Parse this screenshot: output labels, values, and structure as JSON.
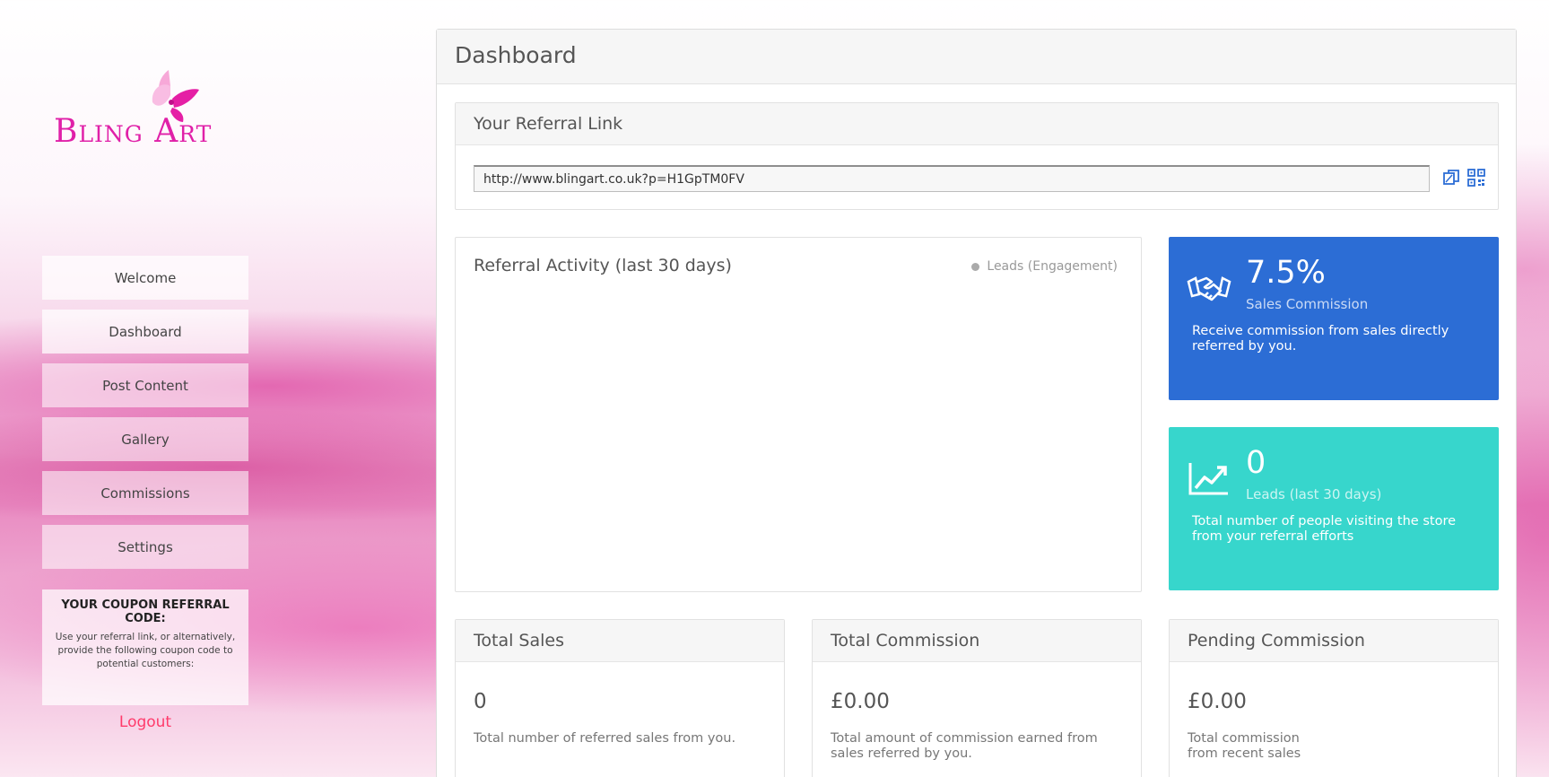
{
  "brand": {
    "logo_text": "Bling Art",
    "primary_pink": "#e020a8"
  },
  "sidebar": {
    "items": [
      {
        "label": "Welcome"
      },
      {
        "label": "Dashboard"
      },
      {
        "label": "Post Content"
      },
      {
        "label": "Gallery"
      },
      {
        "label": "Commissions"
      },
      {
        "label": "Settings"
      }
    ],
    "coupon": {
      "title": "YOUR COUPON REFERRAL CODE:",
      "text": "Use your referral link, or alternatively, provide the following coupon code to potential customers:"
    },
    "logout": "Logout"
  },
  "main": {
    "title": "Dashboard",
    "referral": {
      "title": "Your Referral Link",
      "url": "http://www.blingart.co.uk?p=H1GpTM0FV",
      "copy_icon": "copy-icon",
      "qr_icon": "qr-code-icon"
    },
    "activity": {
      "title": "Referral Activity (last 30 days)",
      "legend": "Leads (Engagement)"
    },
    "commission_box": {
      "value": "7.5%",
      "label": "Sales Commission",
      "desc": "Receive commission from sales directly referred by you.",
      "color": "#2c6dd5",
      "icon": "handshake-icon"
    },
    "leads_box": {
      "value": "0",
      "label": "Leads (last 30 days)",
      "desc": "Total number of people visiting the store from your referral efforts",
      "color": "#37d6cc",
      "icon": "trend-up-icon"
    },
    "total_sales": {
      "title": "Total Sales",
      "value": "0",
      "desc": "Total number of referred sales from you."
    },
    "total_commission": {
      "title": "Total Commission",
      "value": "£0.00",
      "desc": "Total amount of commission earned from sales referred by you."
    },
    "pending_commission": {
      "title": "Pending Commission",
      "value": "£0.00",
      "desc": "Total commission from recent sales"
    }
  }
}
